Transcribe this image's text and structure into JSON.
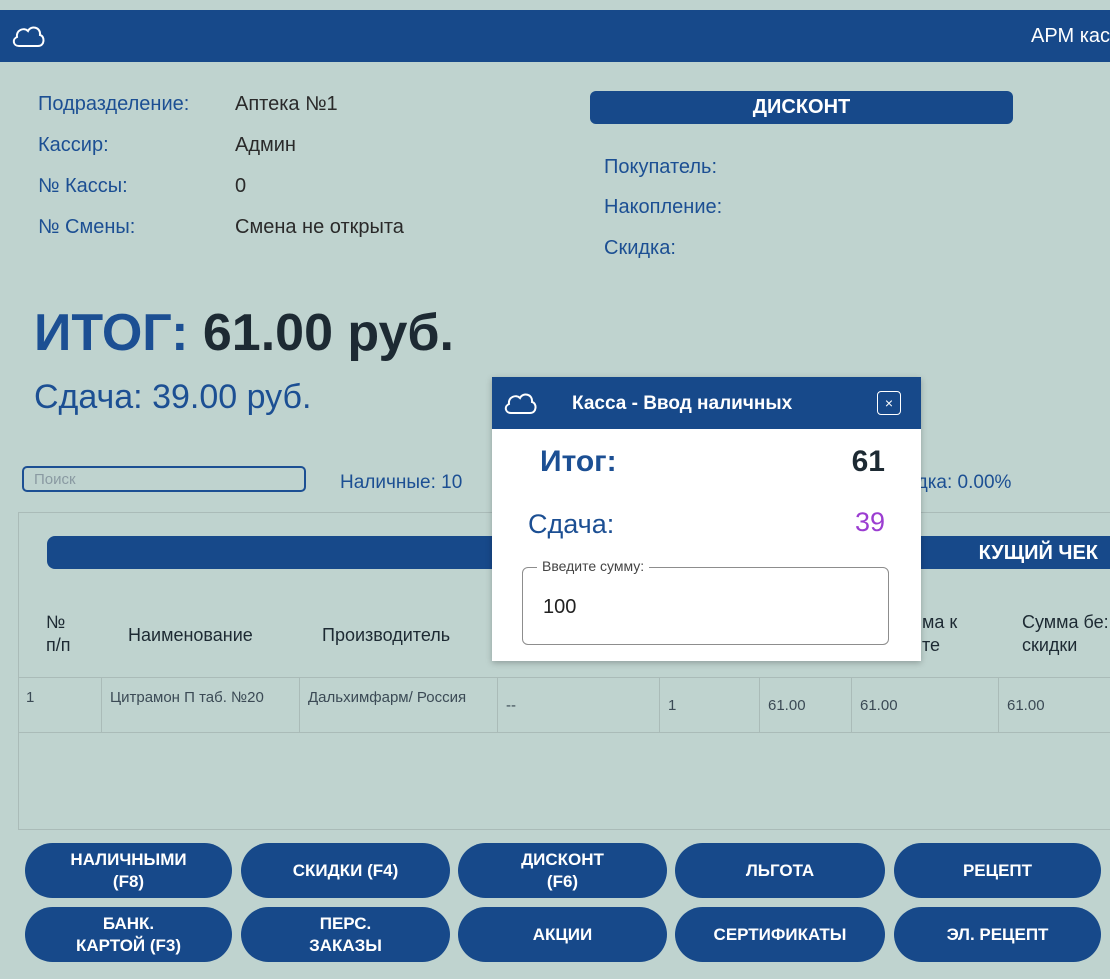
{
  "app": {
    "title": "АРМ кас",
    "colors": {
      "primary": "#17498a",
      "background": "#bfd3cf",
      "accent_change": "#9b3dd1"
    }
  },
  "info": {
    "division_label": "Подразделение:",
    "division_value": "Аптека №1",
    "cashier_label": "Кассир:",
    "cashier_value": "Админ",
    "register_label": "№ Кассы:",
    "register_value": "0",
    "shift_label": "№ Смены:",
    "shift_value": "Смена не открыта"
  },
  "discount": {
    "header": "ДИСКОНТ",
    "buyer_label": "Покупатель:",
    "accumulation_label": "Накопление:",
    "discount_label": "Скидка:"
  },
  "totals": {
    "total_label": "ИТОГ:",
    "total_value": "61.00 руб.",
    "change_label": "Сдача:",
    "change_value": "39.00 руб."
  },
  "search": {
    "placeholder": "Поиск"
  },
  "summary": {
    "cash_text": "Наличные: 10",
    "discount_text": "идка: 0.00%"
  },
  "receipt": {
    "header": "КУЩИЙ ЧЕК",
    "columns": {
      "num_line1": "№",
      "num_line2": "п/п",
      "name": "Наименование",
      "manufacturer": "Производитель",
      "topay_line1": "ма к",
      "topay_line2": "те",
      "nodisc_line1": "Сумма бе:",
      "nodisc_line2": "скидки"
    },
    "rows": [
      {
        "num": "1",
        "name": "Цитрамон П таб. №20",
        "manufacturer": "Дальхимфарм/ Россия",
        "series": "--",
        "qty": "1",
        "price": "61.00",
        "to_pay": "61.00",
        "no_discount": "61.00"
      }
    ]
  },
  "buttons": {
    "cash": "НАЛИЧНЫМИ\n(F8)",
    "discounts": "СКИДКИ (F4)",
    "discount_card": "ДИСКОНТ\n(F6)",
    "benefit": "ЛЬГОТА",
    "prescription": "РЕЦЕПТ",
    "bank_card": "БАНК.\nКАРТОЙ (F3)",
    "personal_orders": "ПЕРС.\nЗАКАЗЫ",
    "promotions": "АКЦИИ",
    "certificates": "СЕРТИФИКАТЫ",
    "e_prescription": "ЭЛ. РЕЦЕПТ"
  },
  "dialog": {
    "title": "Касса - Ввод наличных",
    "close_glyph": "×",
    "total_label": "Итог:",
    "total_value": "61",
    "change_label": "Сдача:",
    "change_value": "39",
    "field_label": "Введите сумму:",
    "field_value": "100"
  }
}
